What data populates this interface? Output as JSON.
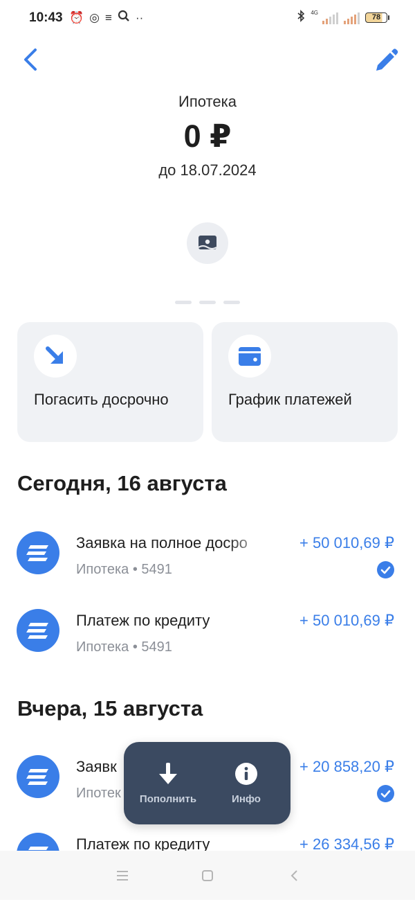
{
  "status_bar": {
    "time": "10:43",
    "network": "4G",
    "battery": "78",
    "icons_left": [
      "alarm-icon",
      "app-icon",
      "list-icon",
      "search-icon",
      "more-icon"
    ],
    "icons_right": [
      "bluetooth-icon",
      "signal-icon",
      "signal-icon",
      "battery-icon"
    ]
  },
  "header": {
    "title": "Ипотека",
    "balance": "0 ₽",
    "due": "до 18.07.2024"
  },
  "actions": [
    {
      "label": "Погасить досрочно",
      "icon": "arrow-down-right-icon"
    },
    {
      "label": "График платежей",
      "icon": "wallet-icon"
    }
  ],
  "sections": [
    {
      "title": "Сегодня, 16 августа",
      "items": [
        {
          "name": "Заявка на полное досро",
          "sub": "Ипотека • 5491",
          "amount": "+ 50 010,69 ₽",
          "checked": true
        },
        {
          "name": "Платеж по кредиту",
          "sub": "Ипотека • 5491",
          "amount": "+ 50 010,69 ₽",
          "checked": false
        }
      ]
    },
    {
      "title": "Вчера, 15 августа",
      "items": [
        {
          "name": "Заявк",
          "sub": "Ипотек",
          "amount": "+ 20 858,20 ₽",
          "checked": true
        },
        {
          "name": "Платеж по кредиту",
          "sub": "",
          "amount": "+ 26 334,56 ₽",
          "checked": false
        }
      ]
    }
  ],
  "floating_panel": {
    "topup_label": "Пополнить",
    "info_label": "Инфо"
  },
  "colors": {
    "accent": "#3a7ee8",
    "panel": "#3b4a61",
    "card_bg": "#f0f2f5"
  }
}
